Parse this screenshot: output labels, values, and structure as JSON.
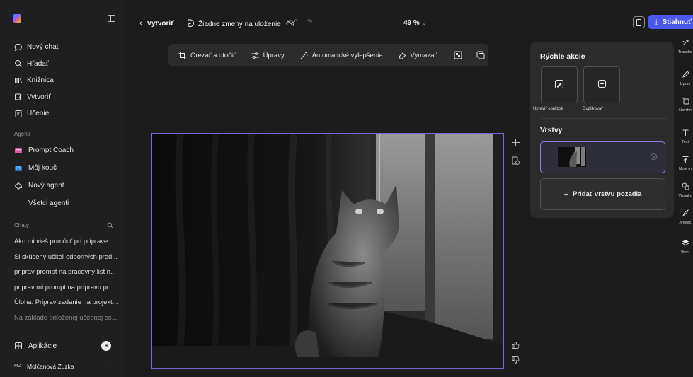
{
  "sidebar": {
    "nav": [
      {
        "label": "Nový chat",
        "icon": "chat-bubble-icon"
      },
      {
        "label": "Hľadať",
        "icon": "search-icon"
      },
      {
        "label": "Knižnica",
        "icon": "library-icon"
      },
      {
        "label": "Vytvoriť",
        "icon": "create-icon"
      },
      {
        "label": "Učenie",
        "icon": "learning-icon"
      }
    ],
    "agents_label": "Agenti",
    "agents": [
      {
        "label": "Prompt Coach",
        "icon": "prompt-coach-icon"
      },
      {
        "label": "Môj kouč",
        "icon": "coach-icon"
      },
      {
        "label": "Nový agent",
        "icon": "new-agent-icon"
      },
      {
        "label": "Všetci agenti",
        "icon": "more-dots-icon"
      }
    ],
    "chats_label": "Chaty",
    "chats": [
      "Ako mi vieš pomôcť pri príprave ...",
      "Si skúsený učiteľ odborných pred...",
      "priprav prompt na pracovný list n...",
      "priprav mi prompt na prípravu pr...",
      "Úloha: Priprav zadanie na projekt...",
      "Na základe priloženej učebnej os..."
    ],
    "apps_label": "Aplikácie",
    "apps_badge": "9",
    "user_initials": "MZ",
    "user_name": "Molčanová Zuzka",
    "user_more": "···"
  },
  "topbar": {
    "back_label": "Vytvoriť",
    "save_status": "Žiadne zmeny na uloženie",
    "zoom": "49 %",
    "download_label": "Stiahnuť"
  },
  "toolbar": {
    "crop": "Orezať a otočiť",
    "adjust": "Úpravy",
    "auto": "Automatické vylepšenie",
    "erase": "Vymazať"
  },
  "panel": {
    "quick_actions_title": "Rýchle akcie",
    "edit_image": "Upraviť obrázok",
    "duplicate": "Duplikovať",
    "layers_title": "Vrstvy",
    "add_background": "Pridať vrstvu pozadia"
  },
  "rail": [
    {
      "label": "Transfor",
      "icon": "transform-icon"
    },
    {
      "label": "Uprav",
      "icon": "pencil-icon"
    },
    {
      "label": "Navrhn",
      "icon": "design-icon"
    },
    {
      "label": "Text",
      "icon": "text-icon"
    },
    {
      "label": "Moje m",
      "icon": "upload-icon"
    },
    {
      "label": "Vizuálni",
      "icon": "shapes-icon"
    },
    {
      "label": "Anotác",
      "icon": "annotate-icon"
    },
    {
      "label": "Vrstv",
      "icon": "layers-icon"
    }
  ],
  "colors": {
    "accent": "#4b57e8",
    "selection": "#7a64d8",
    "background": "#1c1c1c",
    "panel": "#2b2b2b"
  }
}
